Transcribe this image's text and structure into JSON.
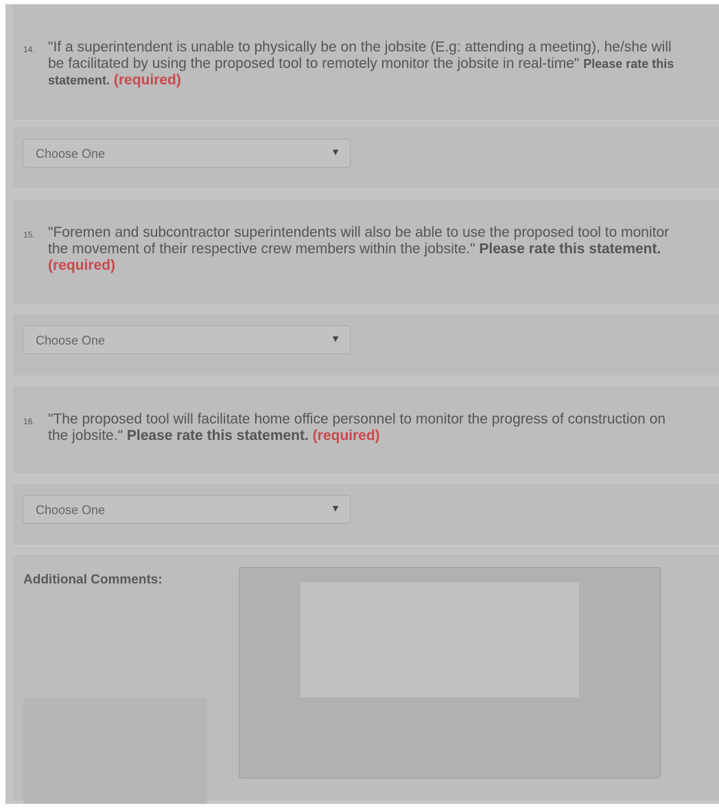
{
  "questions": [
    {
      "number": "14.",
      "text": "\"If a superintendent is unable to physically be on the jobsite (E.g: attending a meeting), he/she will be facilitated by using the proposed tool to remotely monitor the jobsite in real-time\"",
      "prompt": "Please rate this statement.",
      "required": "(required)",
      "select_value": "Choose One"
    },
    {
      "number": "15.",
      "text": "\"Foremen and subcontractor superintendents will also be able to use the proposed tool to monitor the movement of their respective crew members within the jobsite.\"",
      "prompt": "Please rate this statement.",
      "required": "(required)",
      "select_value": "Choose One"
    },
    {
      "number": "16.",
      "text": "\"The proposed tool will facilitate home office personnel to monitor the progress of construction on the jobsite.\"",
      "prompt": "Please rate this statement.",
      "required": "(required)",
      "select_value": "Choose One"
    }
  ],
  "comments": {
    "label": "Additional Comments:",
    "value": ""
  },
  "icons": {
    "dropdown": "chevron-down-icon"
  },
  "colors": {
    "required": "#c9494f",
    "background": "#c4c4c4"
  }
}
